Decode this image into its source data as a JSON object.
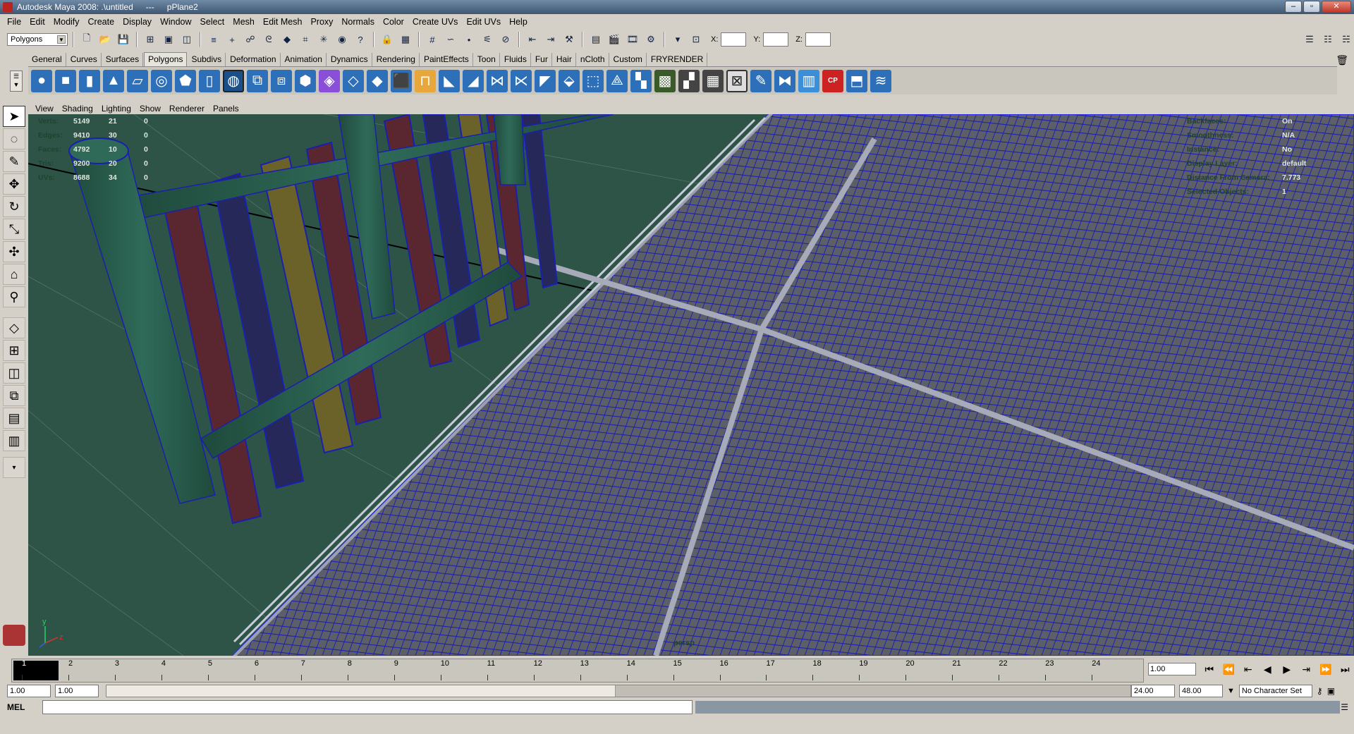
{
  "window": {
    "app_title": "Autodesk Maya 2008: .\\untitled",
    "separator": "---",
    "object": "pPlane2"
  },
  "menus": [
    "File",
    "Edit",
    "Modify",
    "Create",
    "Display",
    "Window",
    "Select",
    "Mesh",
    "Edit Mesh",
    "Proxy",
    "Normals",
    "Color",
    "Create UVs",
    "Edit UVs",
    "Help"
  ],
  "status_line": {
    "mode_selector": "Polygons",
    "x_label": "X:",
    "y_label": "Y:",
    "z_label": "Z:",
    "x_value": "",
    "y_value": "",
    "z_value": ""
  },
  "shelf_tabs": [
    "General",
    "Curves",
    "Surfaces",
    "Polygons",
    "Subdivs",
    "Deformation",
    "Animation",
    "Dynamics",
    "Rendering",
    "PaintEffects",
    "Toon",
    "Fluids",
    "Fur",
    "Hair",
    "nCloth",
    "Custom",
    "FRYRENDER"
  ],
  "active_shelf_tab": "Polygons",
  "shelf_icon_labels": {
    "cp": "CP"
  },
  "panel_menu": [
    "View",
    "Shading",
    "Lighting",
    "Show",
    "Renderer",
    "Panels"
  ],
  "hud_left": [
    {
      "label": "Verts:",
      "v1": "5149",
      "v2": "21",
      "v3": "0"
    },
    {
      "label": "Edges:",
      "v1": "9410",
      "v2": "30",
      "v3": "0"
    },
    {
      "label": "Faces:",
      "v1": "4792",
      "v2": "10",
      "v3": "0"
    },
    {
      "label": "Tris:",
      "v1": "9200",
      "v2": "20",
      "v3": "0"
    },
    {
      "label": "UVs:",
      "v1": "8688",
      "v2": "34",
      "v3": "0"
    }
  ],
  "hud_right": [
    {
      "label": "Backfaces:",
      "value": "On"
    },
    {
      "label": "Smoothness:",
      "value": "N/A"
    },
    {
      "label": "Instance:",
      "value": "No"
    },
    {
      "label": "Display Layer:",
      "value": "default"
    },
    {
      "label": "Distance From Camera:",
      "value": "7.773"
    },
    {
      "label": "Selected Objects:",
      "value": "1"
    }
  ],
  "viewport_camera": "persp",
  "axis_labels": {
    "y": "y",
    "z": "z"
  },
  "timeline": {
    "frames": [
      "1",
      "2",
      "3",
      "4",
      "5",
      "6",
      "7",
      "8",
      "9",
      "10",
      "11",
      "12",
      "13",
      "14",
      "15",
      "16",
      "17",
      "18",
      "19",
      "20",
      "21",
      "22",
      "23",
      "24"
    ],
    "current_frame": "1.00"
  },
  "range": {
    "start": "1.00",
    "anim_start": "1.00",
    "end": "24.00",
    "anim_end": "48.00",
    "character_set": "No Character Set"
  },
  "command_line": {
    "label": "MEL",
    "value": ""
  },
  "colors": {
    "viewport_bg": "#2d5447",
    "wire": "#1a1fb0",
    "floor_face": "#5a5c66",
    "rail_green": "#2b5a4a"
  }
}
